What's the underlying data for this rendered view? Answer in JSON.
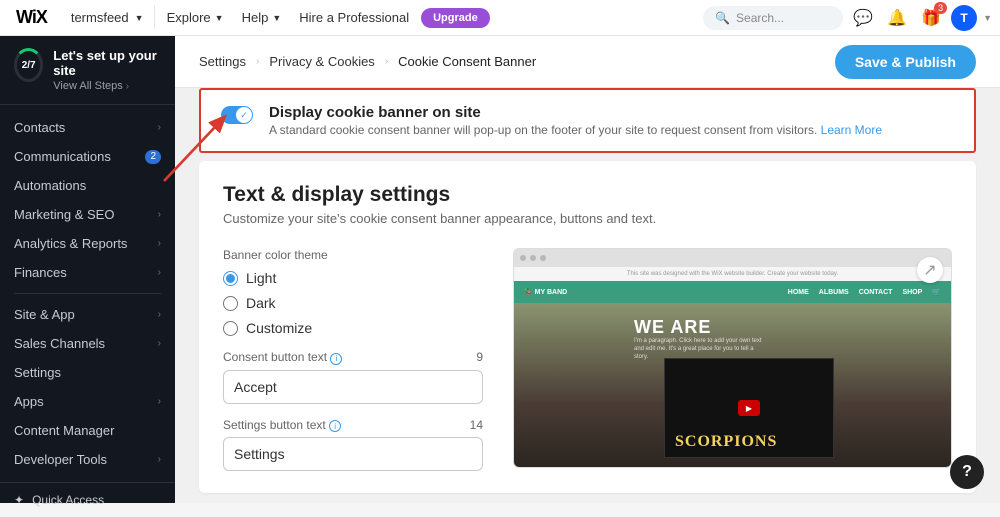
{
  "topbar": {
    "logo": "WiX",
    "site": "termsfeed",
    "explore": "Explore",
    "help": "Help",
    "hire": "Hire a Professional",
    "upgrade": "Upgrade",
    "search": "Search...",
    "badge": "3",
    "avatar": "T"
  },
  "setup": {
    "progress": "2/7",
    "title": "Let's set up your site",
    "steps": "View All Steps"
  },
  "menu": {
    "contacts": "Contacts",
    "comm": "Communications",
    "comm_count": "2",
    "auto": "Automations",
    "marketing": "Marketing & SEO",
    "analytics": "Analytics & Reports",
    "finances": "Finances",
    "siteapp": "Site & App",
    "sales": "Sales Channels",
    "settings": "Settings",
    "apps": "Apps",
    "content": "Content Manager",
    "dev": "Developer Tools",
    "quick": "Quick Access"
  },
  "crumbs": {
    "a": "Settings",
    "b": "Privacy & Cookies",
    "c": "Cookie Consent Banner"
  },
  "publish": "Save & Publish",
  "toggle": {
    "title": "Display cookie banner on site",
    "desc": "A standard cookie consent banner will pop-up on the footer of your site to request consent from visitors. ",
    "link": "Learn More"
  },
  "section": {
    "title": "Text & display settings",
    "sub": "Customize your site's cookie consent banner appearance, buttons and text."
  },
  "theme": {
    "label": "Banner color theme",
    "light": "Light",
    "dark": "Dark",
    "custom": "Customize"
  },
  "consent": {
    "label": "Consent button text",
    "count": "9",
    "value": "Accept"
  },
  "settings_btn": {
    "label": "Settings button text",
    "count": "14",
    "value": "Settings"
  },
  "preview": {
    "brand": "🦆 MY BAND",
    "nav1": "HOME",
    "nav2": "ALBUMS",
    "nav3": "CONTACT",
    "nav4": "SHOP",
    "hero": "WE ARE",
    "scorpions": "SCORPIONS"
  }
}
